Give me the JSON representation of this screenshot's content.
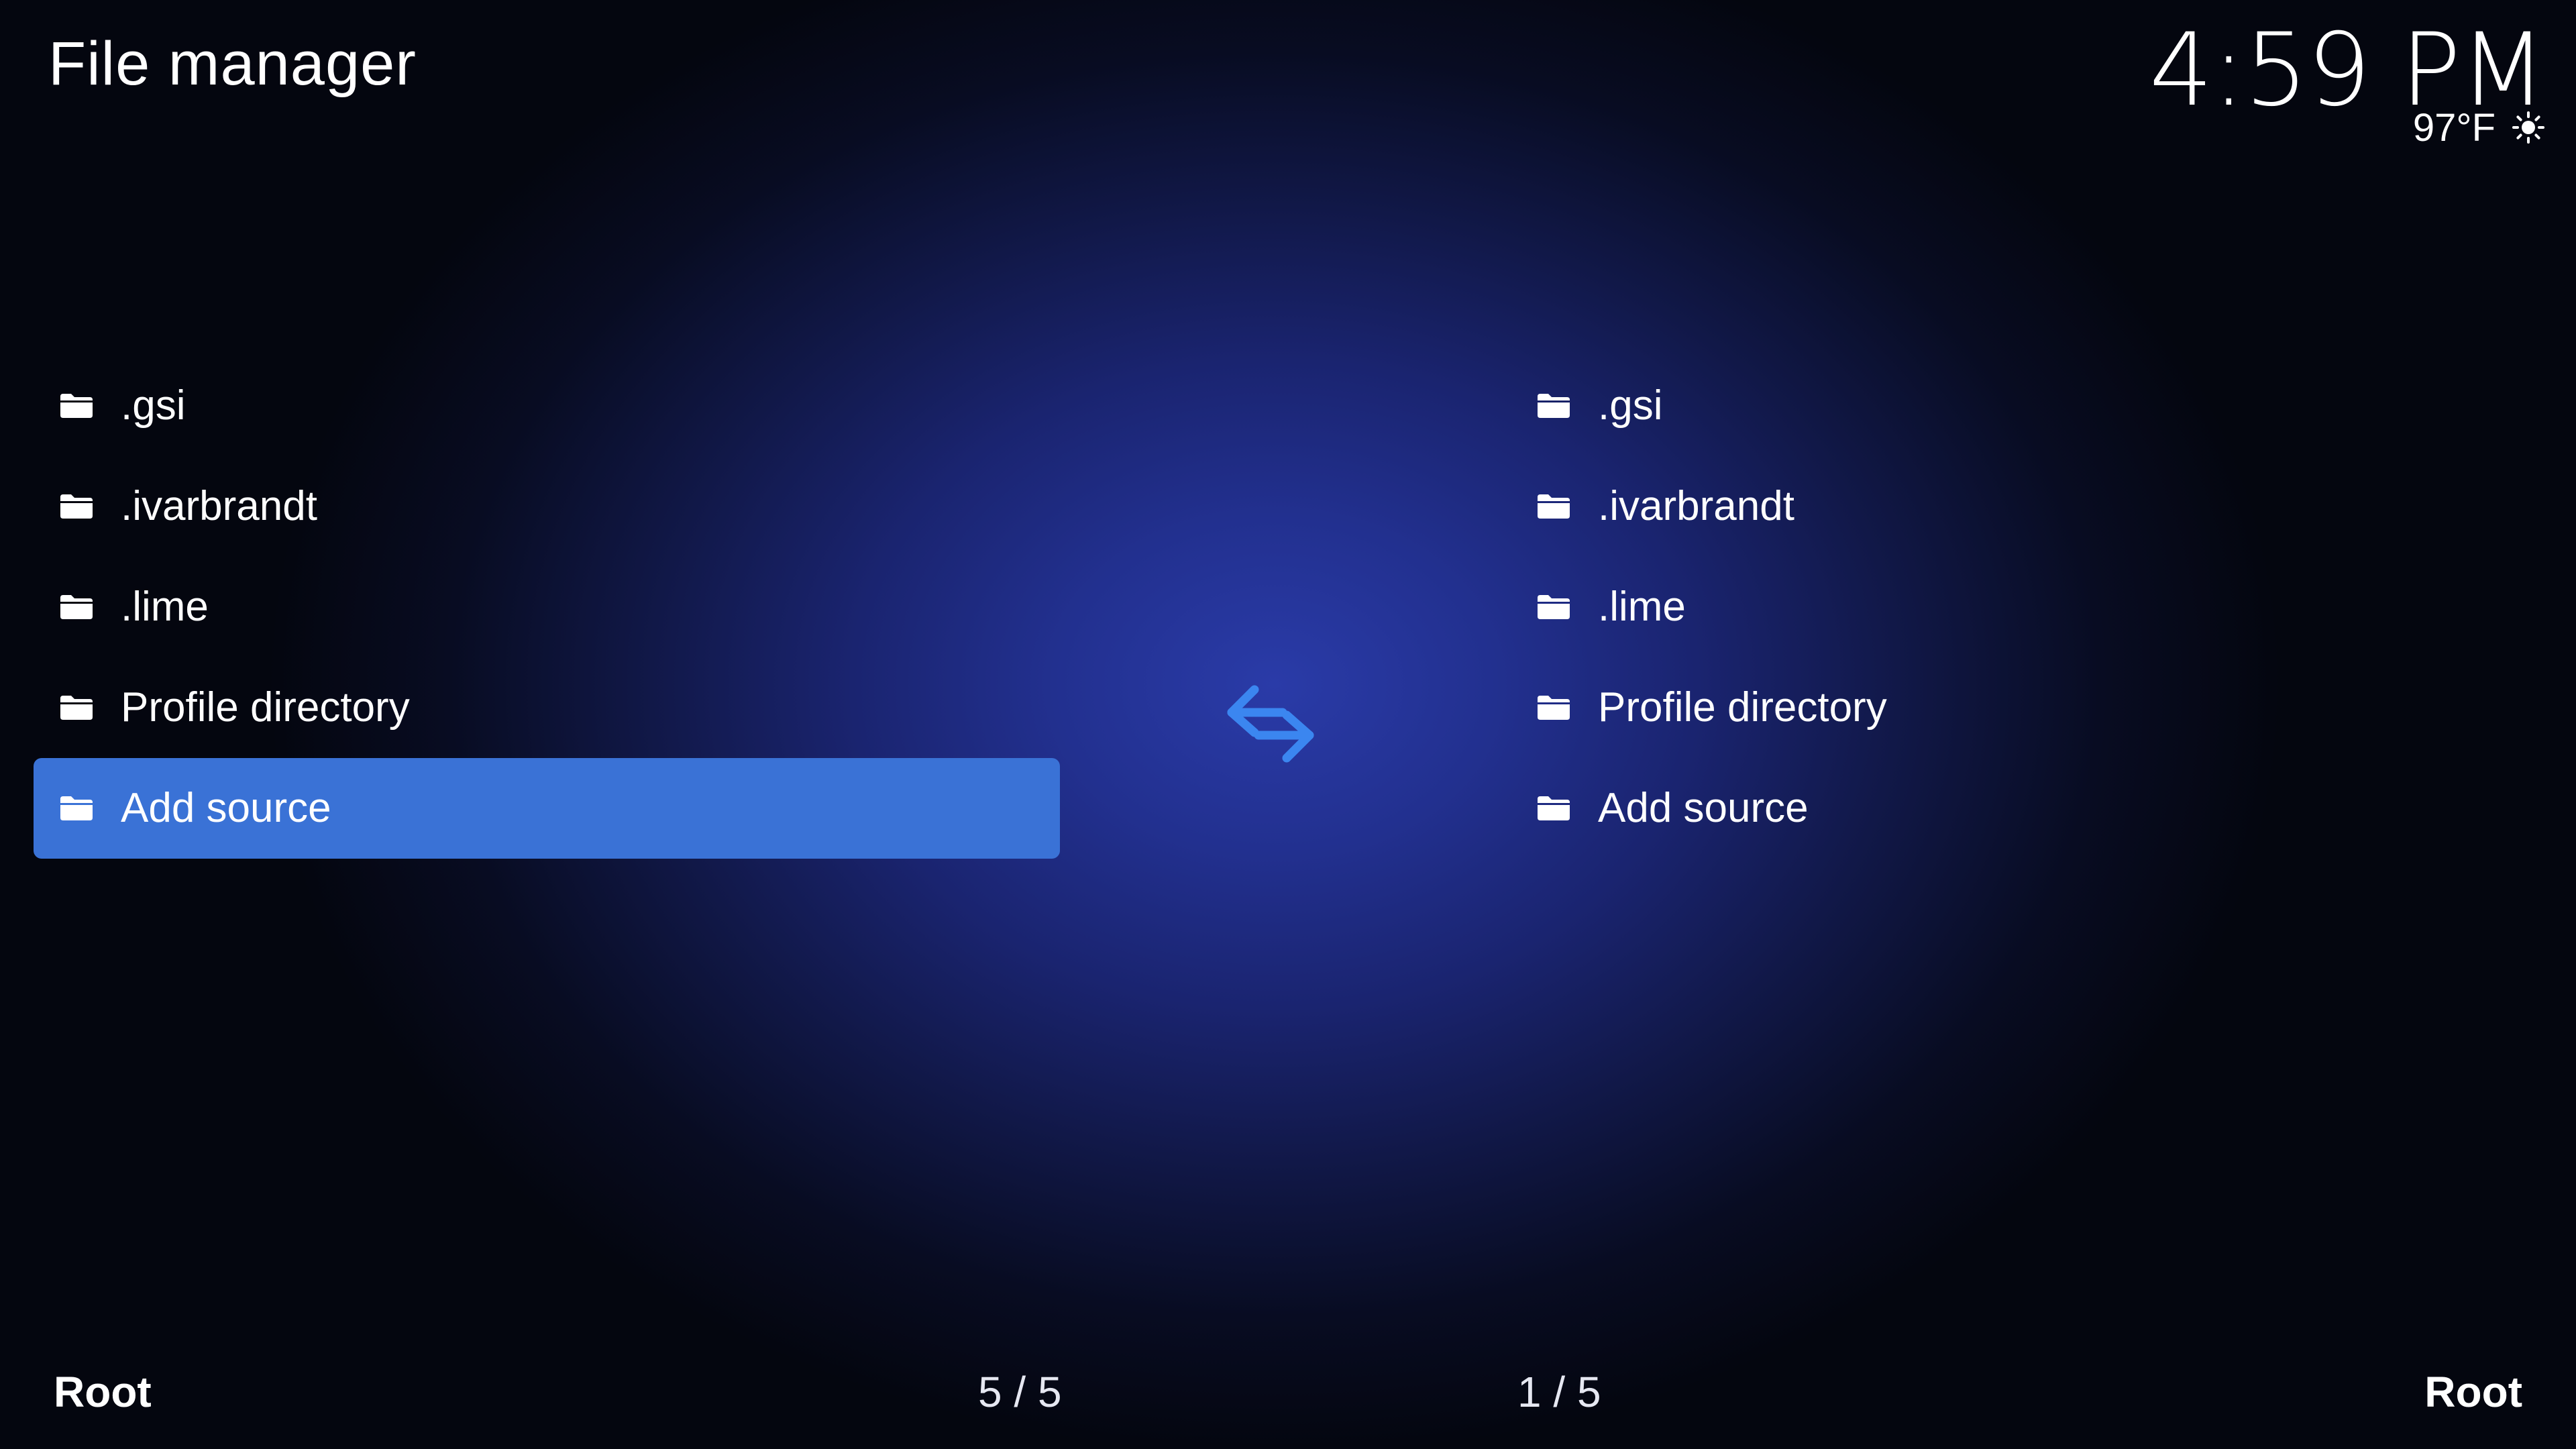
{
  "header": {
    "title": "File manager"
  },
  "status": {
    "time": "4:59 PM",
    "temperature": "97°F",
    "weather_icon": "sun-icon"
  },
  "left_panel": {
    "items": [
      {
        "label": ".gsi",
        "icon": "folder-icon"
      },
      {
        "label": ".ivarbrandt",
        "icon": "folder-icon"
      },
      {
        "label": ".lime",
        "icon": "folder-icon"
      },
      {
        "label": "Profile directory",
        "icon": "folder-icon"
      },
      {
        "label": "Add source",
        "icon": "folder-icon",
        "selected": true
      }
    ],
    "path": "Root",
    "count": "5 / 5"
  },
  "right_panel": {
    "items": [
      {
        "label": ".gsi",
        "icon": "folder-icon"
      },
      {
        "label": ".ivarbrandt",
        "icon": "folder-icon"
      },
      {
        "label": ".lime",
        "icon": "folder-icon"
      },
      {
        "label": "Profile directory",
        "icon": "folder-icon"
      },
      {
        "label": "Add source",
        "icon": "folder-icon"
      }
    ],
    "path": "Root",
    "count": "1 / 5"
  },
  "swap_icon": "swap-arrows-icon",
  "colors": {
    "selection": "#3a72d6",
    "swap_arrows": "#3b86f0",
    "background_center": "#2a3ba8",
    "background_edge": "#04060f"
  }
}
